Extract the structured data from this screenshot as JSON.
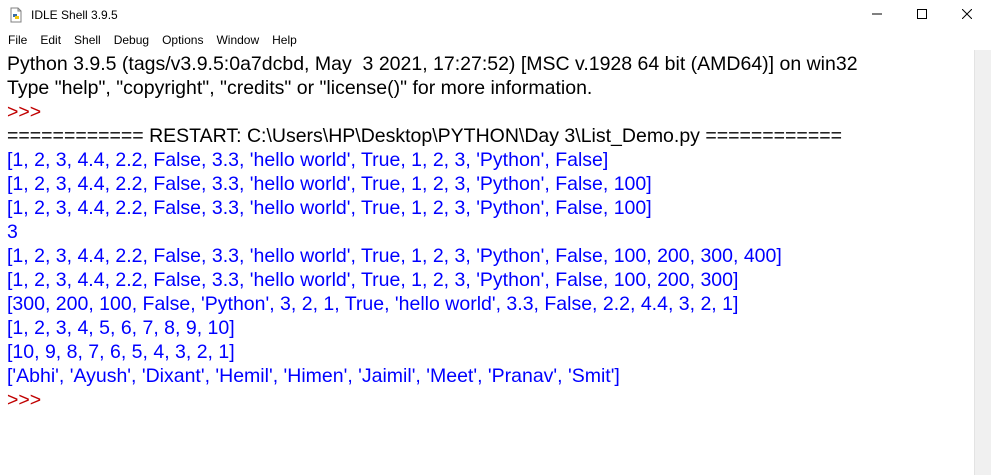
{
  "window": {
    "title": "IDLE Shell 3.9.5",
    "icon": "python-file-icon"
  },
  "menu": [
    "File",
    "Edit",
    "Shell",
    "Debug",
    "Options",
    "Window",
    "Help"
  ],
  "shell": {
    "lines": [
      {
        "text": "Python 3.9.5 (tags/v3.9.5:0a7dcbd, May  3 2021, 17:27:52) [MSC v.1928 64 bit (AMD64)] on win32",
        "kind": "plain"
      },
      {
        "text": "Type \"help\", \"copyright\", \"credits\" or \"license()\" for more information.",
        "kind": "plain"
      },
      {
        "text": ">>> ",
        "kind": "prompt"
      },
      {
        "text": "============ RESTART: C:\\Users\\HP\\Desktop\\PYTHON\\Day 3\\List_Demo.py ============",
        "kind": "plain"
      },
      {
        "text": "[1, 2, 3, 4.4, 2.2, False, 3.3, 'hello world', True, 1, 2, 3, 'Python', False]",
        "kind": "stdout"
      },
      {
        "text": "[1, 2, 3, 4.4, 2.2, False, 3.3, 'hello world', True, 1, 2, 3, 'Python', False, 100]",
        "kind": "stdout"
      },
      {
        "text": "[1, 2, 3, 4.4, 2.2, False, 3.3, 'hello world', True, 1, 2, 3, 'Python', False, 100]",
        "kind": "stdout"
      },
      {
        "text": "3",
        "kind": "stdout"
      },
      {
        "text": "[1, 2, 3, 4.4, 2.2, False, 3.3, 'hello world', True, 1, 2, 3, 'Python', False, 100, 200, 300, 400]",
        "kind": "stdout"
      },
      {
        "text": "[1, 2, 3, 4.4, 2.2, False, 3.3, 'hello world', True, 1, 2, 3, 'Python', False, 100, 200, 300]",
        "kind": "stdout"
      },
      {
        "text": "[300, 200, 100, False, 'Python', 3, 2, 1, True, 'hello world', 3.3, False, 2.2, 4.4, 3, 2, 1]",
        "kind": "stdout"
      },
      {
        "text": "[1, 2, 3, 4, 5, 6, 7, 8, 9, 10]",
        "kind": "stdout"
      },
      {
        "text": "[10, 9, 8, 7, 6, 5, 4, 3, 2, 1]",
        "kind": "stdout"
      },
      {
        "text": "['Abhi', 'Ayush', 'Dixant', 'Hemil', 'Himen', 'Jaimil', 'Meet', 'Pranav', 'Smit']",
        "kind": "stdout"
      },
      {
        "text": ">>> ",
        "kind": "prompt"
      }
    ]
  },
  "colors": {
    "stdout": "#0000ff",
    "prompt": "#c00000",
    "plain": "#000000"
  }
}
